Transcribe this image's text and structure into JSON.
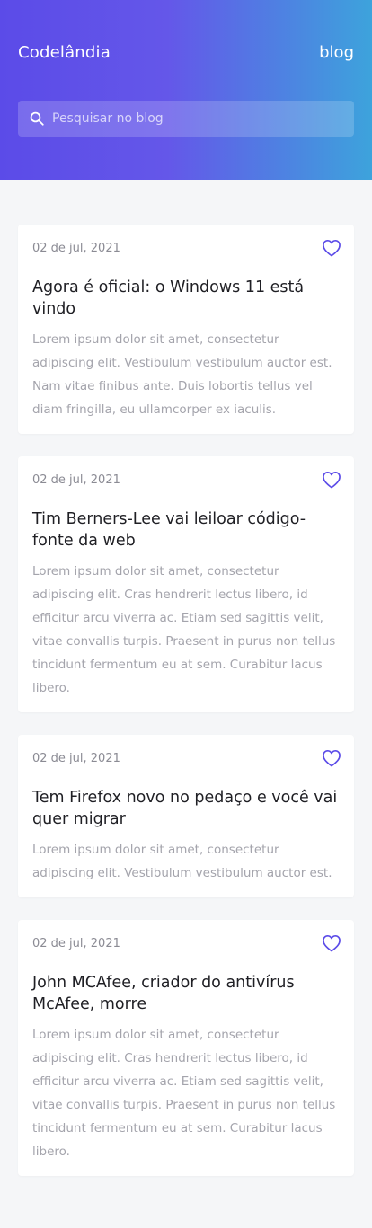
{
  "header": {
    "brand": "Codelândia",
    "nav_blog": "blog",
    "search": {
      "placeholder": "Pesquisar no blog",
      "value": ""
    }
  },
  "colors": {
    "accent": "#5b4be8",
    "gradient_end": "#3da3dc",
    "heart": "#5b4be8"
  },
  "posts": [
    {
      "date": "02 de jul, 2021",
      "title": "Agora é oficial: o Windows 11 está vindo",
      "excerpt": "Lorem ipsum dolor sit amet, consectetur adipiscing elit. Vestibulum vestibulum auctor est. Nam vitae finibus ante. Duis lobortis tellus vel diam fringilla, eu ullamcorper ex iaculis."
    },
    {
      "date": "02 de jul, 2021",
      "title": "Tim Berners-Lee vai leiloar código-fonte da web",
      "excerpt": "Lorem ipsum dolor sit amet, consectetur adipiscing elit. Cras hendrerit lectus libero, id efficitur arcu viverra ac. Etiam sed sagittis velit, vitae convallis turpis. Praesent in purus non tellus tincidunt fermentum eu at sem. Curabitur lacus libero."
    },
    {
      "date": "02 de jul, 2021",
      "title": "Tem Firefox novo no pedaço e você vai quer migrar",
      "excerpt": "Lorem ipsum dolor sit amet, consectetur adipiscing elit. Vestibulum vestibulum auctor est."
    },
    {
      "date": "02 de jul, 2021",
      "title": "John MCAfee, criador do antivírus McAfee, morre",
      "excerpt": "Lorem ipsum dolor sit amet, consectetur adipiscing elit. Cras hendrerit lectus libero, id efficitur arcu viverra ac. Etiam sed sagittis velit, vitae convallis turpis. Praesent in purus non tellus tincidunt fermentum eu at sem. Curabitur lacus libero."
    }
  ]
}
